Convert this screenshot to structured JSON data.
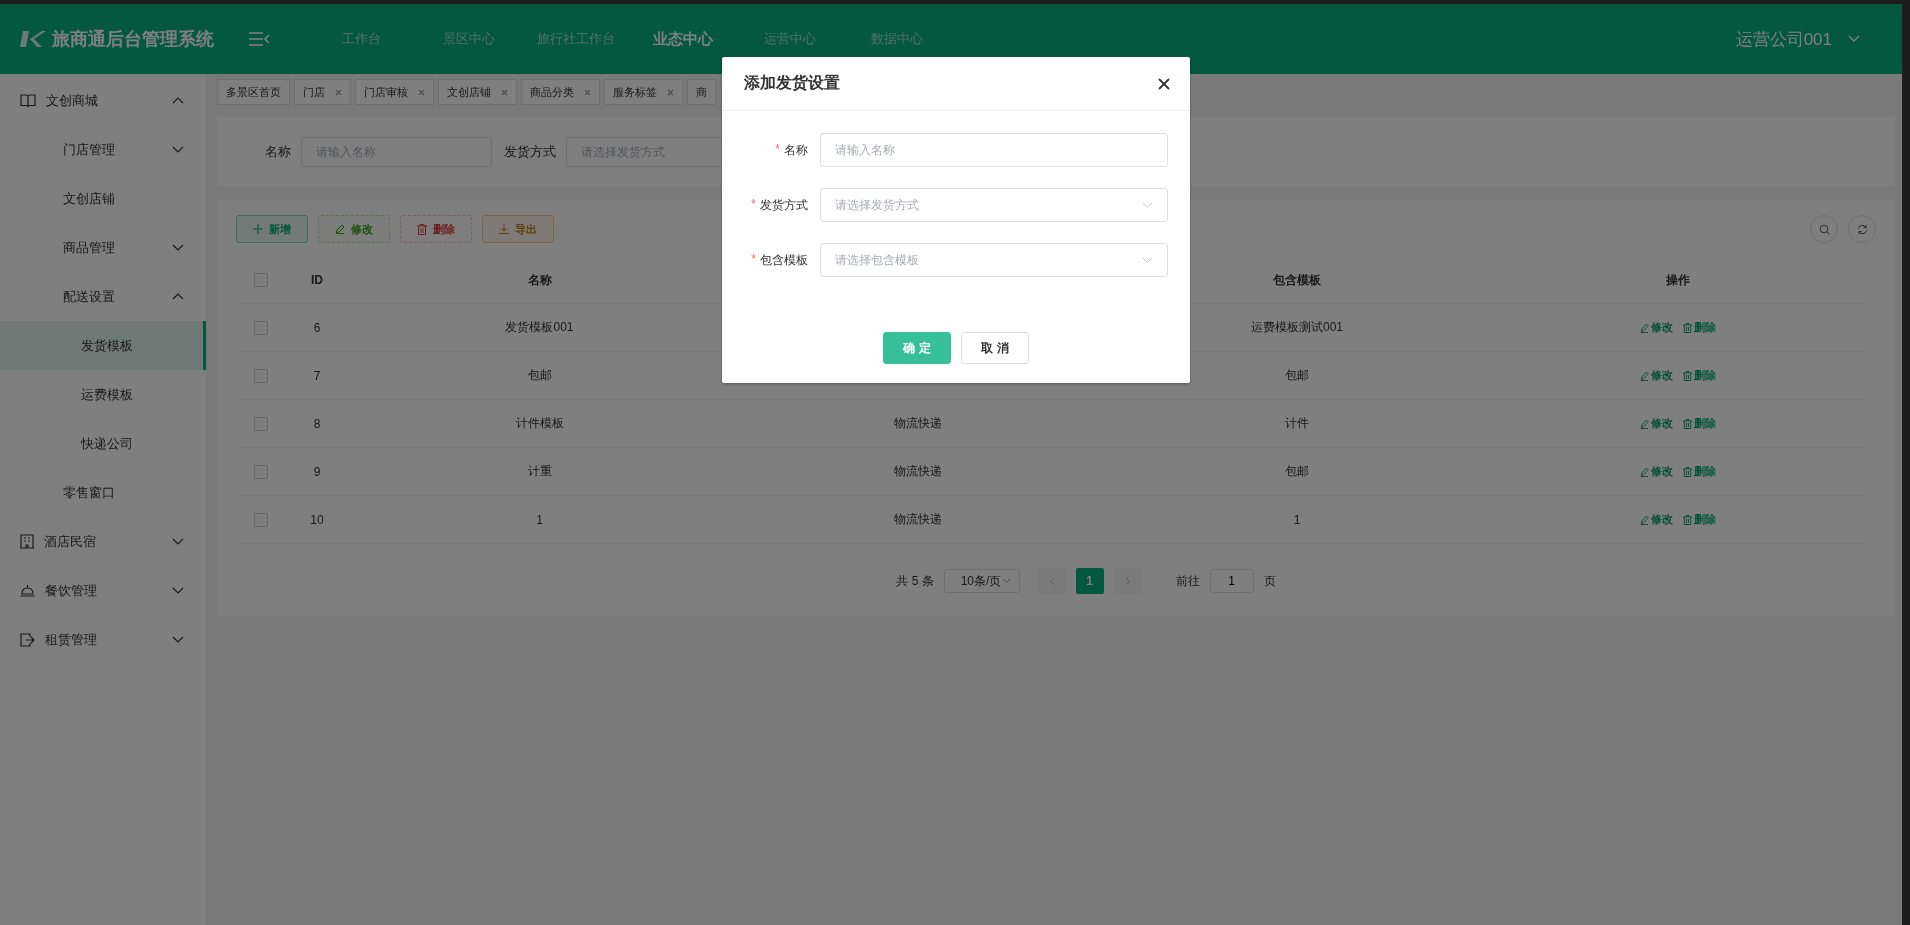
{
  "header": {
    "title": "旅商通后台管理系统",
    "nav": [
      {
        "label": "工作台",
        "selected": false
      },
      {
        "label": "景区中心",
        "selected": false
      },
      {
        "label": "旅行社工作台",
        "selected": false
      },
      {
        "label": "业态中心",
        "selected": true
      },
      {
        "label": "运营中心",
        "selected": false
      },
      {
        "label": "数据中心",
        "selected": false
      }
    ],
    "user": "运营公司001"
  },
  "sidebar": {
    "items": [
      {
        "label": "文创商城",
        "selected": false,
        "expanded": true,
        "children": [
          {
            "label": "门店管理",
            "selected": false,
            "expanded": false
          },
          {
            "label": "文创店铺",
            "selected": false
          },
          {
            "label": "商品管理",
            "selected": false,
            "expanded": false
          },
          {
            "label": "配送设置",
            "selected": false,
            "expanded": true,
            "children": [
              {
                "label": "发货模板",
                "selected": true
              },
              {
                "label": "运费模板",
                "selected": false
              },
              {
                "label": "快递公司",
                "selected": false
              }
            ]
          },
          {
            "label": "零售窗口",
            "selected": false
          }
        ]
      },
      {
        "label": "酒店民宿",
        "selected": false,
        "expanded": false
      },
      {
        "label": "餐饮管理",
        "selected": false,
        "expanded": false
      },
      {
        "label": "租赁管理",
        "selected": false,
        "expanded": false
      }
    ]
  },
  "tabs": [
    {
      "label": "多景区首页",
      "closable": false
    },
    {
      "label": "门店",
      "closable": true
    },
    {
      "label": "门店审核",
      "closable": true
    },
    {
      "label": "文创店铺",
      "closable": true
    },
    {
      "label": "商品分类",
      "closable": true
    },
    {
      "label": "服务标签",
      "closable": true
    },
    {
      "label": "商",
      "closable": false
    }
  ],
  "search": {
    "fields": [
      {
        "label": "名称",
        "placeholder": "请输入名称"
      },
      {
        "label": "发货方式",
        "placeholder": "请选择发货方式"
      }
    ]
  },
  "toolbar": [
    {
      "kind": "add",
      "label": "新增",
      "disabled": false
    },
    {
      "kind": "edit",
      "label": "修改",
      "disabled": true
    },
    {
      "kind": "delete",
      "label": "删除",
      "disabled": true
    },
    {
      "kind": "export",
      "label": "导出",
      "disabled": false
    }
  ],
  "table": {
    "columns": {
      "id": "ID",
      "name": "名称",
      "template": "包含模板",
      "actions": "操作"
    },
    "header_checked": false,
    "rows": [
      {
        "checked": false,
        "id": "6",
        "name": "发货模板001",
        "template": "运费模板测试001",
        "actions": [
          "修改",
          "删除"
        ]
      },
      {
        "checked": false,
        "id": "7",
        "name": "包邮",
        "template": "包邮",
        "actions": [
          "修改",
          "删除"
        ]
      },
      {
        "checked": false,
        "id": "8",
        "name": "计件模板",
        "column_3": "物流快递",
        "template": "计件",
        "actions": [
          "修改",
          "删除"
        ]
      },
      {
        "checked": false,
        "id": "9",
        "name": "计重",
        "column_3": "物流快递",
        "template": "包邮",
        "actions": [
          "修改",
          "删除"
        ]
      },
      {
        "checked": false,
        "id": "10",
        "name": "1",
        "column_3": "物流快递",
        "template": "1",
        "actions": [
          "修改",
          "删除"
        ]
      }
    ]
  },
  "pagination": {
    "total": "共 5 条",
    "page_size": "10条/页",
    "pages": [
      {
        "label": "1",
        "selected": true
      }
    ],
    "goto_label": "前往",
    "goto_value": "1",
    "goto_suffix": "页"
  },
  "dialog": {
    "title": "添加发货设置",
    "fields": [
      {
        "kind": "input",
        "required_mark": "*",
        "label": "名称",
        "placeholder": "请输入名称"
      },
      {
        "kind": "select",
        "required_mark": "*",
        "label": "发货方式",
        "placeholder": "请选择发货方式"
      },
      {
        "kind": "select",
        "required_mark": "*",
        "label": "包含模板",
        "placeholder": "请选择包含模板"
      }
    ],
    "buttons": [
      {
        "kind": "primary",
        "label": "确 定"
      },
      {
        "kind": "default",
        "label": "取 消"
      }
    ]
  }
}
